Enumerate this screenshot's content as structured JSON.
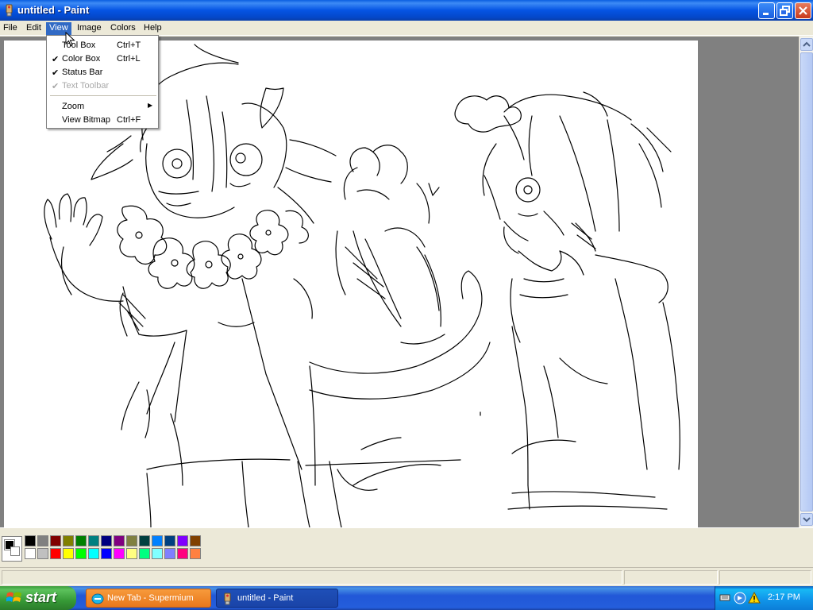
{
  "window": {
    "title": "untitled - Paint"
  },
  "menu": [
    "File",
    "Edit",
    "View",
    "Image",
    "Colors",
    "Help"
  ],
  "active_menu": "View",
  "view_menu": {
    "items": [
      {
        "label": "Tool Box",
        "shortcut": "Ctrl+T",
        "checked": false,
        "disabled": false
      },
      {
        "label": "Color Box",
        "shortcut": "Ctrl+L",
        "checked": true,
        "disabled": false
      },
      {
        "label": "Status Bar",
        "shortcut": "",
        "checked": true,
        "disabled": false
      },
      {
        "label": "Text Toolbar",
        "shortcut": "",
        "checked": true,
        "disabled": true
      },
      {
        "label": "Zoom",
        "shortcut": "",
        "checked": false,
        "disabled": false,
        "submenu": true
      },
      {
        "label": "View Bitmap",
        "shortcut": "Ctrl+F",
        "checked": false,
        "disabled": false
      }
    ],
    "check_glyph": "✔",
    "submenu_glyph": "▶"
  },
  "palette": {
    "foreground": "#000000",
    "background": "#ffffff",
    "row1": [
      "#000000",
      "#808080",
      "#800000",
      "#808000",
      "#008000",
      "#008080",
      "#000080",
      "#800080",
      "#808040",
      "#004040",
      "#0080ff",
      "#004080",
      "#8000ff",
      "#804000"
    ],
    "row2": [
      "#ffffff",
      "#c0c0c0",
      "#ff0000",
      "#ffff00",
      "#00ff00",
      "#00ffff",
      "#0000ff",
      "#ff00ff",
      "#ffff80",
      "#00ff80",
      "#80ffff",
      "#8080ff",
      "#ff0080",
      "#ff8040"
    ]
  },
  "taskbar": {
    "start_label": "start",
    "tasks": [
      {
        "label": "New Tab - Supermium",
        "icon": "supermium-icon"
      },
      {
        "label": "untitled - Paint",
        "icon": "paint-icon"
      }
    ],
    "time": "2:17 PM",
    "tray_icons": [
      "keyboard-icon",
      "network-icon",
      "security-alert-icon"
    ]
  }
}
